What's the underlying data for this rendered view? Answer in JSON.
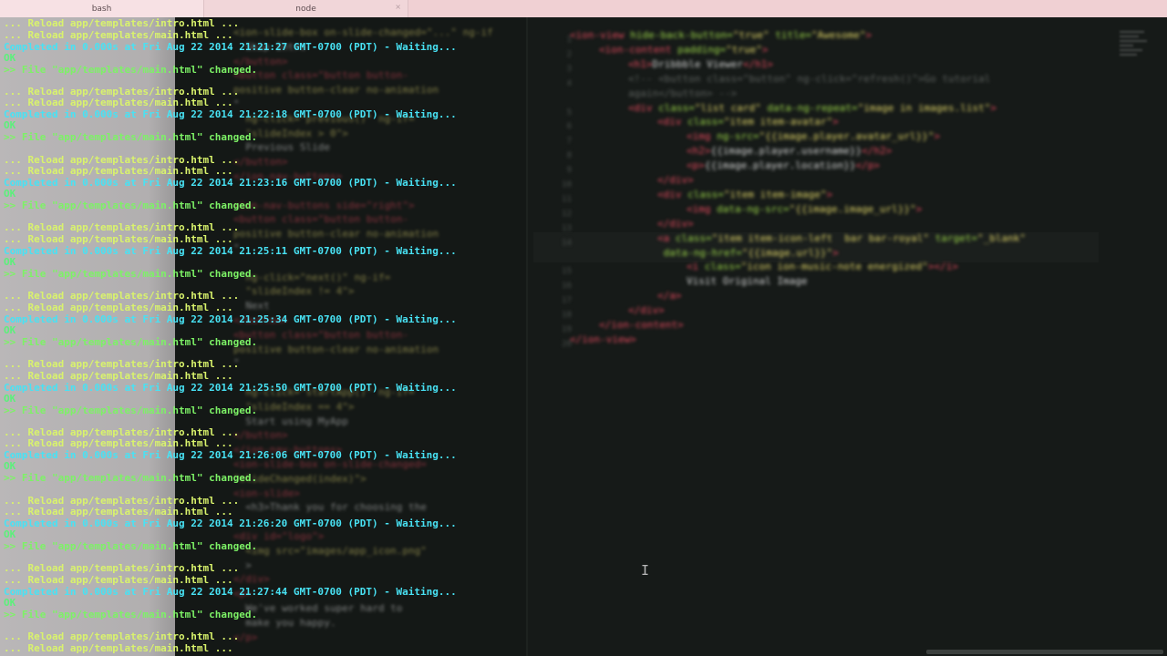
{
  "tabs": [
    {
      "label": "bash",
      "active": true
    },
    {
      "label": "node",
      "active": false
    }
  ],
  "terminal": {
    "lines": [
      {
        "kind": "reload",
        "text": "... Reload app/templates/intro.html ..."
      },
      {
        "kind": "reload",
        "text": "... Reload app/templates/main.html ..."
      },
      {
        "kind": "done",
        "text": "Completed in 0.000s at Fri Aug 22 2014 21:21:27 GMT-0700 (PDT) - Waiting..."
      },
      {
        "kind": "ok",
        "text": "OK"
      },
      {
        "kind": "changed",
        "text": ">> File \"app/templates/main.html\" changed."
      },
      {
        "kind": "reload",
        "text": "... Reload app/templates/intro.html ..."
      },
      {
        "kind": "reload",
        "text": "... Reload app/templates/main.html ..."
      },
      {
        "kind": "done",
        "text": "Completed in 0.000s at Fri Aug 22 2014 21:22:18 GMT-0700 (PDT) - Waiting..."
      },
      {
        "kind": "ok",
        "text": "OK"
      },
      {
        "kind": "changed",
        "text": ">> File \"app/templates/main.html\" changed."
      },
      {
        "kind": "reload",
        "text": "... Reload app/templates/intro.html ..."
      },
      {
        "kind": "reload",
        "text": "... Reload app/templates/main.html ..."
      },
      {
        "kind": "done",
        "text": "Completed in 0.000s at Fri Aug 22 2014 21:23:16 GMT-0700 (PDT) - Waiting..."
      },
      {
        "kind": "ok",
        "text": "OK"
      },
      {
        "kind": "changed",
        "text": ">> File \"app/templates/main.html\" changed."
      },
      {
        "kind": "reload",
        "text": "... Reload app/templates/intro.html ..."
      },
      {
        "kind": "reload",
        "text": "... Reload app/templates/main.html ..."
      },
      {
        "kind": "done",
        "text": "Completed in 0.000s at Fri Aug 22 2014 21:25:11 GMT-0700 (PDT) - Waiting..."
      },
      {
        "kind": "ok",
        "text": "OK"
      },
      {
        "kind": "changed",
        "text": ">> File \"app/templates/main.html\" changed."
      },
      {
        "kind": "reload",
        "text": "... Reload app/templates/intro.html ..."
      },
      {
        "kind": "reload",
        "text": "... Reload app/templates/main.html ..."
      },
      {
        "kind": "done",
        "text": "Completed in 0.000s at Fri Aug 22 2014 21:25:34 GMT-0700 (PDT) - Waiting..."
      },
      {
        "kind": "ok",
        "text": "OK"
      },
      {
        "kind": "changed",
        "text": ">> File \"app/templates/main.html\" changed."
      },
      {
        "kind": "reload",
        "text": "... Reload app/templates/intro.html ..."
      },
      {
        "kind": "reload",
        "text": "... Reload app/templates/main.html ..."
      },
      {
        "kind": "done",
        "text": "Completed in 0.000s at Fri Aug 22 2014 21:25:50 GMT-0700 (PDT) - Waiting..."
      },
      {
        "kind": "ok",
        "text": "OK"
      },
      {
        "kind": "changed",
        "text": ">> File \"app/templates/main.html\" changed."
      },
      {
        "kind": "reload",
        "text": "... Reload app/templates/intro.html ..."
      },
      {
        "kind": "reload",
        "text": "... Reload app/templates/main.html ..."
      },
      {
        "kind": "done",
        "text": "Completed in 0.000s at Fri Aug 22 2014 21:26:06 GMT-0700 (PDT) - Waiting..."
      },
      {
        "kind": "ok",
        "text": "OK"
      },
      {
        "kind": "changed",
        "text": ">> File \"app/templates/main.html\" changed."
      },
      {
        "kind": "reload",
        "text": "... Reload app/templates/intro.html ..."
      },
      {
        "kind": "reload",
        "text": "... Reload app/templates/main.html ..."
      },
      {
        "kind": "done",
        "text": "Completed in 0.000s at Fri Aug 22 2014 21:26:20 GMT-0700 (PDT) - Waiting..."
      },
      {
        "kind": "ok",
        "text": "OK"
      },
      {
        "kind": "changed",
        "text": ">> File \"app/templates/main.html\" changed."
      },
      {
        "kind": "reload",
        "text": "... Reload app/templates/intro.html ..."
      },
      {
        "kind": "reload",
        "text": "... Reload app/templates/main.html ..."
      },
      {
        "kind": "done",
        "text": "Completed in 0.000s at Fri Aug 22 2014 21:27:44 GMT-0700 (PDT) - Waiting..."
      },
      {
        "kind": "ok",
        "text": "OK"
      },
      {
        "kind": "changed",
        "text": ">> File \"app/templates/main.html\" changed."
      },
      {
        "kind": "reload",
        "text": "... Reload app/templates/intro.html ..."
      },
      {
        "kind": "reload",
        "text": "... Reload app/templates/main.html ..."
      }
    ],
    "ghost_lines": [
      {
        "kind": "str",
        "text": "<ion-slide-box on-slide-changed=\"...\" ng-if"
      },
      {
        "kind": "plain",
        "text": "  Skip Intro"
      },
      {
        "kind": "tag",
        "text": "</button>"
      },
      {
        "kind": "tag",
        "text": "<button class=\"button button-"
      },
      {
        "kind": "str",
        "text": "positive button-clear no-animation"
      },
      {
        "kind": "plain",
        "text": "\""
      },
      {
        "kind": "str",
        "text": "  ng-click=\"previous()\" ng-if="
      },
      {
        "kind": "str",
        "text": "  \"slideIndex > 0\">"
      },
      {
        "kind": "plain",
        "text": "  Previous Slide"
      },
      {
        "kind": "tag",
        "text": "</button>"
      },
      {
        "kind": "tag",
        "text": "</ion-nav-buttons>"
      },
      {
        "kind": "plain",
        "text": ""
      },
      {
        "kind": "tag",
        "text": "<ion-nav-buttons side=\"right\">"
      },
      {
        "kind": "tag",
        "text": "<button class=\"button button-"
      },
      {
        "kind": "str",
        "text": "positive button-clear no-animation"
      },
      {
        "kind": "plain",
        "text": "\""
      },
      {
        "kind": "plain",
        "text": ""
      },
      {
        "kind": "str",
        "text": "  ng-click=\"next()\" ng-if="
      },
      {
        "kind": "str",
        "text": "  \"slideIndex != 4\">"
      },
      {
        "kind": "plain",
        "text": "  Next"
      },
      {
        "kind": "tag",
        "text": "</button>"
      },
      {
        "kind": "tag",
        "text": "<button class=\"button button-"
      },
      {
        "kind": "str",
        "text": "positive button-clear no-animation"
      },
      {
        "kind": "plain",
        "text": "\""
      },
      {
        "kind": "plain",
        "text": ""
      },
      {
        "kind": "str",
        "text": "  ng-click=\"startApp()\" ng-if="
      },
      {
        "kind": "str",
        "text": "  \"slideIndex == 4\">"
      },
      {
        "kind": "plain",
        "text": "  Start using MyApp"
      },
      {
        "kind": "tag",
        "text": "</button>"
      },
      {
        "kind": "tag",
        "text": "</ion-nav-buttons>"
      },
      {
        "kind": "tag",
        "text": "<ion-slide-box on-slide-changed="
      },
      {
        "kind": "str",
        "text": "\"slideChanged(index)\">"
      },
      {
        "kind": "tag",
        "text": "<ion-slide>"
      },
      {
        "kind": "plain",
        "text": "  <h3>Thank you for choosing the"
      },
      {
        "kind": "plain",
        "text": ""
      },
      {
        "kind": "tag",
        "text": "<div id=\"logo\">"
      },
      {
        "kind": "str",
        "text": "  <img src=\"images/app_icon.png\""
      },
      {
        "kind": "plain",
        "text": "  >"
      },
      {
        "kind": "tag",
        "text": "</div>"
      },
      {
        "kind": "tag",
        "text": "<p>"
      },
      {
        "kind": "plain",
        "text": "  We've worked super hard to"
      },
      {
        "kind": "plain",
        "text": "  make you happy."
      },
      {
        "kind": "tag",
        "text": "</p>"
      }
    ]
  },
  "editor": {
    "line_numbers": [
      "1",
      "2",
      "3",
      "4",
      "",
      "5",
      "6",
      "7",
      "8",
      "9",
      "10",
      "11",
      "12",
      "13",
      "14",
      "",
      "15",
      "16",
      "17",
      "18",
      "19",
      "20"
    ],
    "code": [
      {
        "indent": 0,
        "parts": [
          [
            "t",
            "<ion-view"
          ],
          [
            "a",
            " hide-back-button="
          ],
          [
            "s",
            "\"true\""
          ],
          [
            "a",
            " title="
          ],
          [
            "s",
            "\"Awesome\""
          ],
          [
            "t",
            ">"
          ]
        ]
      },
      {
        "indent": 1,
        "parts": [
          [
            "t",
            "<ion-content"
          ],
          [
            "a",
            " padding="
          ],
          [
            "s",
            "\"true\""
          ],
          [
            "t",
            ">"
          ]
        ]
      },
      {
        "indent": 2,
        "parts": [
          [
            "t",
            "<h1>"
          ],
          [
            "p",
            "Dribbble Viewer"
          ],
          [
            "t",
            "</h1>"
          ]
        ]
      },
      {
        "indent": 2,
        "parts": [
          [
            "c",
            "<!-- <button class=\"button\" ng-click=\"refresh()\">Go tutorial"
          ]
        ]
      },
      {
        "indent": 2,
        "parts": [
          [
            "c",
            "again</button> -->"
          ]
        ]
      },
      {
        "indent": 2,
        "parts": [
          [
            "t",
            "<div"
          ],
          [
            "a",
            " class="
          ],
          [
            "s",
            "\"list card\""
          ],
          [
            "a",
            " data-ng-repeat="
          ],
          [
            "s",
            "\"image in images.list\""
          ],
          [
            "t",
            ">"
          ]
        ]
      },
      {
        "indent": 3,
        "parts": [
          [
            "t",
            "<div"
          ],
          [
            "a",
            " class="
          ],
          [
            "s",
            "\"item item-avatar\""
          ],
          [
            "t",
            ">"
          ]
        ]
      },
      {
        "indent": 4,
        "parts": [
          [
            "t",
            "<img"
          ],
          [
            "a",
            " ng-src="
          ],
          [
            "s",
            "\"{{image.player.avatar_url}}\""
          ],
          [
            "t",
            ">"
          ]
        ]
      },
      {
        "indent": 4,
        "parts": [
          [
            "t",
            "<h2>"
          ],
          [
            "p",
            "{{image.player.username}}"
          ],
          [
            "t",
            "</h2>"
          ]
        ]
      },
      {
        "indent": 4,
        "parts": [
          [
            "t",
            "<p>"
          ],
          [
            "p",
            "{{image.player.location}}"
          ],
          [
            "t",
            "</p>"
          ]
        ]
      },
      {
        "indent": 3,
        "parts": [
          [
            "t",
            "</div>"
          ]
        ]
      },
      {
        "indent": 3,
        "parts": [
          [
            "t",
            "<div"
          ],
          [
            "a",
            " class="
          ],
          [
            "s",
            "\"item item-image\""
          ],
          [
            "t",
            ">"
          ]
        ]
      },
      {
        "indent": 4,
        "parts": [
          [
            "t",
            "<img"
          ],
          [
            "a",
            " data-ng-src="
          ],
          [
            "s",
            "\"{{image.image_url}}\""
          ],
          [
            "t",
            ">"
          ]
        ]
      },
      {
        "indent": 3,
        "parts": [
          [
            "t",
            "</div>"
          ]
        ]
      },
      {
        "indent": 3,
        "parts": [
          [
            "t",
            "<a"
          ],
          [
            "a",
            " class="
          ],
          [
            "s",
            "\"item item-icon-left  bar bar-royal\""
          ],
          [
            "a",
            " target="
          ],
          [
            "s",
            "\"_blank\""
          ]
        ]
      },
      {
        "indent": 3,
        "parts": [
          [
            "a",
            " data-ng-href="
          ],
          [
            "s",
            "\"{{image.url}}\""
          ],
          [
            "t",
            ">"
          ]
        ]
      },
      {
        "indent": 4,
        "parts": [
          [
            "t",
            "<i"
          ],
          [
            "a",
            " class="
          ],
          [
            "s",
            "\"icon ion-music-note energized\""
          ],
          [
            "t",
            "></i>"
          ]
        ]
      },
      {
        "indent": 4,
        "parts": [
          [
            "p",
            "Visit Original Image"
          ]
        ]
      },
      {
        "indent": 3,
        "parts": [
          [
            "t",
            "</a>"
          ]
        ]
      },
      {
        "indent": 2,
        "parts": [
          [
            "t",
            "</div>"
          ]
        ]
      },
      {
        "indent": 1,
        "parts": [
          [
            "t",
            "</ion-content>"
          ]
        ]
      },
      {
        "indent": 0,
        "parts": [
          [
            "t",
            "</ion-view>"
          ]
        ]
      }
    ]
  },
  "colors": {
    "tabbar": "#f1d6d9",
    "terminal_bg": "#141816",
    "editor_bg": "#161a18",
    "reload": "#d9f36c",
    "completed": "#48e2f4",
    "changed": "#7df266",
    "tag": "#e3495d",
    "string": "#e0d568"
  }
}
